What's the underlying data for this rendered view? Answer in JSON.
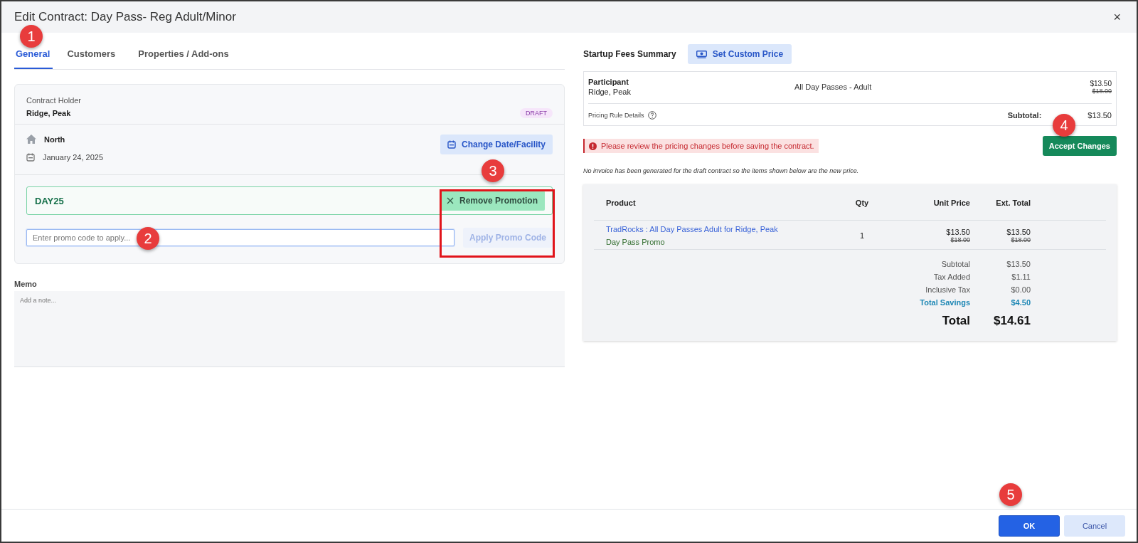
{
  "window": {
    "title": "Edit Contract: Day Pass- Reg Adult/Minor",
    "close": "×"
  },
  "tabs": [
    {
      "label": "General",
      "selected": true
    },
    {
      "label": "Customers",
      "selected": false
    },
    {
      "label": "Properties / Add-ons",
      "selected": false
    }
  ],
  "contract": {
    "holder_label": "Contract Holder",
    "holder": "Ridge, Peak",
    "status": "DRAFT",
    "facility": "North",
    "date": "January 24, 2025",
    "change_button": "Change Date/Facility"
  },
  "promotion": {
    "applied_code": "DAY25",
    "remove_button": "Remove Promotion",
    "placeholder": "Enter promo code to apply...",
    "apply_button": {
      "label": "Apply Promo Code",
      "disabled": true
    }
  },
  "memo": {
    "label": "Memo",
    "placeholder": "Add a note..."
  },
  "summary": {
    "title": "Startup Fees Summary",
    "custom_price_button": "Set Custom Price",
    "fee": {
      "role": "Participant",
      "name": "Ridge, Peak",
      "item": "All Day Passes - Adult",
      "price": "$13.50",
      "old_price": "$18.00"
    },
    "rule_details": "Pricing Rule Details",
    "subtotal_label": "Subtotal:",
    "subtotal": "$13.50"
  },
  "warning": "Please review the pricing changes before saving the contract.",
  "accept_button": "Accept Changes",
  "note": "No invoice has been generated for the draft contract so the items shown below are the new price.",
  "invoice": {
    "columns": [
      "Product",
      "Qty",
      "Unit Price",
      "Ext. Total"
    ],
    "rows": [
      {
        "product": "TradRocks : All Day Passes Adult for Ridge, Peak",
        "promo": "Day Pass Promo",
        "qty": "1",
        "unit_price": "$13.50",
        "unit_old": "$18.00",
        "total": "$13.50",
        "total_old": "$18.00"
      }
    ],
    "totals": [
      {
        "kind": "normal",
        "label": "Subtotal",
        "value": "$13.50"
      },
      {
        "kind": "normal",
        "label": "Tax Added",
        "value": "$1.11"
      },
      {
        "kind": "normal",
        "label": "Inclusive Tax",
        "value": "$0.00"
      },
      {
        "kind": "savings",
        "label": "Total Savings",
        "value": "$4.50"
      },
      {
        "kind": "grand",
        "label": "Total",
        "value": "$14.61"
      }
    ]
  },
  "buttons": [
    {
      "label": "OK",
      "kind": "primary"
    },
    {
      "label": "Cancel",
      "kind": "secondary"
    }
  ],
  "callouts": [
    "1",
    "2",
    "3",
    "4",
    "5"
  ]
}
